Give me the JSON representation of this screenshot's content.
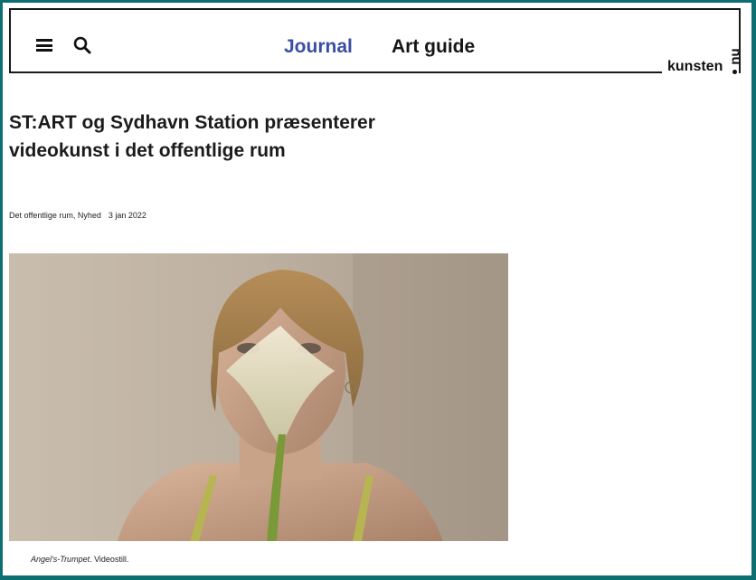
{
  "header": {
    "menu_icon": "hamburger-menu-icon",
    "search_icon": "search-icon",
    "nav": [
      {
        "label": "Journal",
        "active": true
      },
      {
        "label": "Art guide",
        "active": false
      }
    ],
    "logo": {
      "text": "kunsten",
      "suffix": "nu"
    },
    "accent_color": "#3a4fa3"
  },
  "article": {
    "title": "ST:ART og Sydhavn Station præsenterer videokunst i det offentlige rum",
    "categories": "Det offentlige rum, Nyhed",
    "date": "3 jan 2022",
    "image_caption_title": "Angel's-Trumpet",
    "image_caption_rest": ". Videostill."
  },
  "page_background": "#0e6f73"
}
